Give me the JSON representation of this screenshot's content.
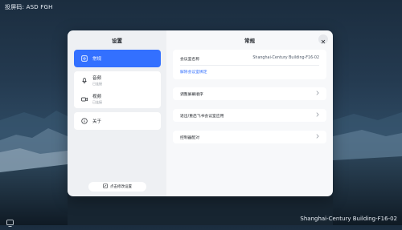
{
  "screen": {
    "share_code": "投屏码: ASD FGH",
    "room_name": "Shanghai-Century Building-F16-02"
  },
  "left_panel": {
    "title": "设置",
    "items": [
      {
        "label": "常规",
        "icon": "settings-general-icon",
        "active": true
      },
      {
        "label": "音频",
        "status": "已连接",
        "icon": "microphone-icon"
      },
      {
        "label": "视频",
        "status": "已连接",
        "icon": "camera-icon"
      },
      {
        "label": "关于",
        "icon": "info-icon"
      }
    ],
    "edit_button": "点击修改设置"
  },
  "right_panel": {
    "title": "常规",
    "room_label": "会议室名称",
    "room_value": "Shanghai-Century Building-F16-02",
    "unbind_link": "解除会议室绑定",
    "rows": [
      "调整屏幕顺序",
      "退出/重启飞书会议室应用",
      "控制器配对"
    ]
  },
  "colors": {
    "accent": "#3370ff",
    "panel_left": "#eef0f3",
    "panel_right": "#f7f8fa"
  }
}
